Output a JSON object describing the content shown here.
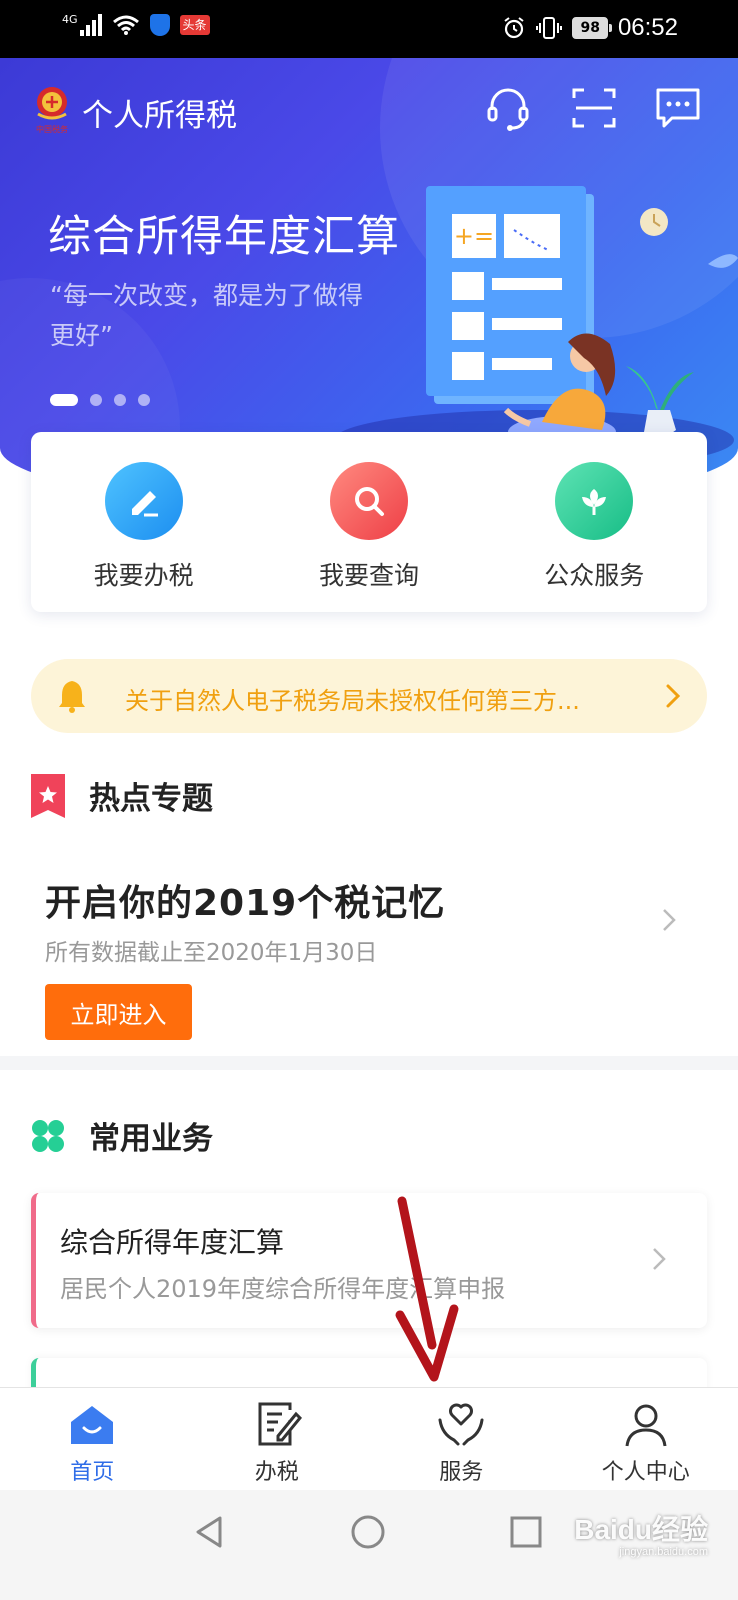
{
  "status_bar": {
    "network": "4G",
    "toutiao_badge": "头条",
    "battery": "98",
    "time": "06:52"
  },
  "header": {
    "app_title": "个人所得税",
    "emblem_text": "中国税务",
    "icons": [
      "headset-icon",
      "scan-icon",
      "message-icon"
    ]
  },
  "banner": {
    "title": "综合所得年度汇算",
    "subtitle": "“每一次改变，都是为了做得更好”",
    "slides": 4,
    "active_slide": 1
  },
  "quick_actions": [
    {
      "label": "我要办税",
      "icon": "edit-icon",
      "color": "#2aa3f2"
    },
    {
      "label": "我要查询",
      "icon": "search-icon",
      "color": "#f2575a"
    },
    {
      "label": "公众服务",
      "icon": "flower-icon",
      "color": "#2dcf9c"
    }
  ],
  "notice": {
    "text": "关于自然人电子税务局未授权任何第三方..."
  },
  "hot_topics": {
    "section_title": "热点专题",
    "title": "开启你的2019个税记忆",
    "subtitle": "所有数据截止至2020年1月30日",
    "button": "立即进入"
  },
  "common_business": {
    "section_title": "常用业务",
    "items": [
      {
        "title": "综合所得年度汇算",
        "subtitle": "居民个人2019年度综合所得年度汇算申报"
      }
    ]
  },
  "tabbar": {
    "tabs": [
      {
        "label": "首页",
        "icon": "home-icon",
        "active": true
      },
      {
        "label": "办税",
        "icon": "document-edit-icon",
        "active": false
      },
      {
        "label": "服务",
        "icon": "heart-hands-icon",
        "active": false
      },
      {
        "label": "个人中心",
        "icon": "person-icon",
        "active": false
      }
    ]
  },
  "watermark": {
    "brand": "Baidu经验",
    "url": "jingyan.baidu.com"
  },
  "colors": {
    "brand_blue": "#2f6de8",
    "hero_gradient_start": "#3c3ad6",
    "hero_gradient_end": "#3b8cf4",
    "notice_text": "#f0a010",
    "cta_orange": "#ff6d0c",
    "annotation_red": "#b3141b"
  }
}
